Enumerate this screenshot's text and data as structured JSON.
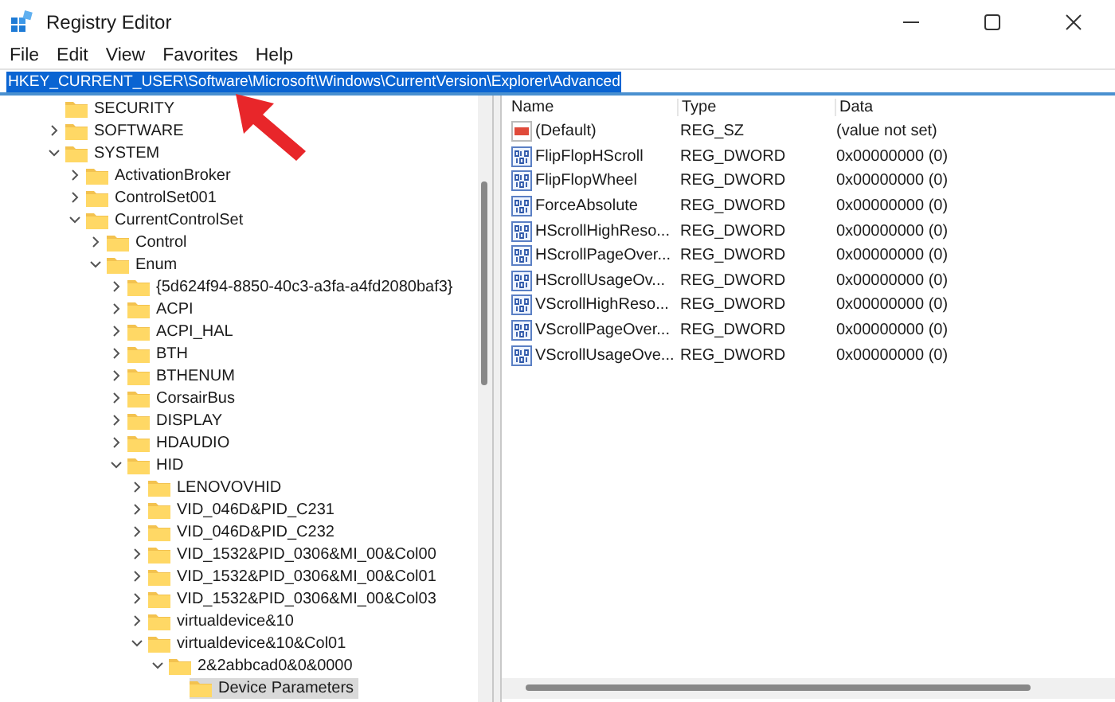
{
  "window": {
    "title": "Registry Editor"
  },
  "menu": [
    "File",
    "Edit",
    "View",
    "Favorites",
    "Help"
  ],
  "address": {
    "value": "HKEY_CURRENT_USER\\Software\\Microsoft\\Windows\\CurrentVersion\\Explorer\\Advanced",
    "selected": true
  },
  "tree": [
    {
      "label": "SECURITY",
      "kind": "leaf",
      "selected": false
    },
    {
      "label": "SOFTWARE",
      "kind": "key",
      "expanded": false,
      "selected": false
    },
    {
      "label": "SYSTEM",
      "kind": "key",
      "expanded": true,
      "selected": false,
      "children": [
        {
          "label": "ActivationBroker",
          "kind": "key",
          "expanded": false,
          "selected": false
        },
        {
          "label": "ControlSet001",
          "kind": "key",
          "expanded": false,
          "selected": false
        },
        {
          "label": "CurrentControlSet",
          "kind": "key",
          "expanded": true,
          "selected": false,
          "children": [
            {
              "label": "Control",
              "kind": "key",
              "expanded": false,
              "selected": false
            },
            {
              "label": "Enum",
              "kind": "key",
              "expanded": true,
              "selected": false,
              "children": [
                {
                  "label": "{5d624f94-8850-40c3-a3fa-a4fd2080baf3}",
                  "kind": "key",
                  "expanded": false,
                  "selected": false
                },
                {
                  "label": "ACPI",
                  "kind": "key",
                  "expanded": false,
                  "selected": false
                },
                {
                  "label": "ACPI_HAL",
                  "kind": "key",
                  "expanded": false,
                  "selected": false
                },
                {
                  "label": "BTH",
                  "kind": "key",
                  "expanded": false,
                  "selected": false
                },
                {
                  "label": "BTHENUM",
                  "kind": "key",
                  "expanded": false,
                  "selected": false
                },
                {
                  "label": "CorsairBus",
                  "kind": "key",
                  "expanded": false,
                  "selected": false
                },
                {
                  "label": "DISPLAY",
                  "kind": "key",
                  "expanded": false,
                  "selected": false
                },
                {
                  "label": "HDAUDIO",
                  "kind": "key",
                  "expanded": false,
                  "selected": false
                },
                {
                  "label": "HID",
                  "kind": "key",
                  "expanded": true,
                  "selected": false,
                  "children": [
                    {
                      "label": "LENOVOVHID",
                      "kind": "key",
                      "expanded": false,
                      "selected": false
                    },
                    {
                      "label": "VID_046D&PID_C231",
                      "kind": "key",
                      "expanded": false,
                      "selected": false
                    },
                    {
                      "label": "VID_046D&PID_C232",
                      "kind": "key",
                      "expanded": false,
                      "selected": false
                    },
                    {
                      "label": "VID_1532&PID_0306&MI_00&Col00",
                      "kind": "key",
                      "expanded": false,
                      "selected": false
                    },
                    {
                      "label": "VID_1532&PID_0306&MI_00&Col01",
                      "kind": "key",
                      "expanded": false,
                      "selected": false
                    },
                    {
                      "label": "VID_1532&PID_0306&MI_00&Col03",
                      "kind": "key",
                      "expanded": false,
                      "selected": false
                    },
                    {
                      "label": "virtualdevice&10",
                      "kind": "key",
                      "expanded": false,
                      "selected": false
                    },
                    {
                      "label": "virtualdevice&10&Col01",
                      "kind": "key",
                      "expanded": true,
                      "selected": false,
                      "children": [
                        {
                          "label": "2&2abbcad0&0&0000",
                          "kind": "key",
                          "expanded": true,
                          "selected": false,
                          "children": [
                            {
                              "label": "Device Parameters",
                              "kind": "leaf",
                              "selected": true
                            }
                          ]
                        }
                      ]
                    }
                  ]
                }
              ]
            }
          ]
        }
      ]
    }
  ],
  "table": {
    "columns": [
      "Name",
      "Type",
      "Data"
    ],
    "rows": [
      {
        "kind": "string",
        "name": "(Default)",
        "type": "REG_SZ",
        "data": "(value not set)"
      },
      {
        "kind": "dword",
        "name": "FlipFlopHScroll",
        "type": "REG_DWORD",
        "data": "0x00000000 (0)"
      },
      {
        "kind": "dword",
        "name": "FlipFlopWheel",
        "type": "REG_DWORD",
        "data": "0x00000000 (0)"
      },
      {
        "kind": "dword",
        "name": "ForceAbsolute",
        "type": "REG_DWORD",
        "data": "0x00000000 (0)"
      },
      {
        "kind": "dword",
        "name": "HScrollHighReso...",
        "type": "REG_DWORD",
        "data": "0x00000000 (0)"
      },
      {
        "kind": "dword",
        "name": "HScrollPageOver...",
        "type": "REG_DWORD",
        "data": "0x00000000 (0)"
      },
      {
        "kind": "dword",
        "name": "HScrollUsageOv...",
        "type": "REG_DWORD",
        "data": "0x00000000 (0)"
      },
      {
        "kind": "dword",
        "name": "VScrollHighReso...",
        "type": "REG_DWORD",
        "data": "0x00000000 (0)"
      },
      {
        "kind": "dword",
        "name": "VScrollPageOver...",
        "type": "REG_DWORD",
        "data": "0x00000000 (0)"
      },
      {
        "kind": "dword",
        "name": "VScrollUsageOve...",
        "type": "REG_DWORD",
        "data": "0x00000000 (0)"
      }
    ]
  }
}
